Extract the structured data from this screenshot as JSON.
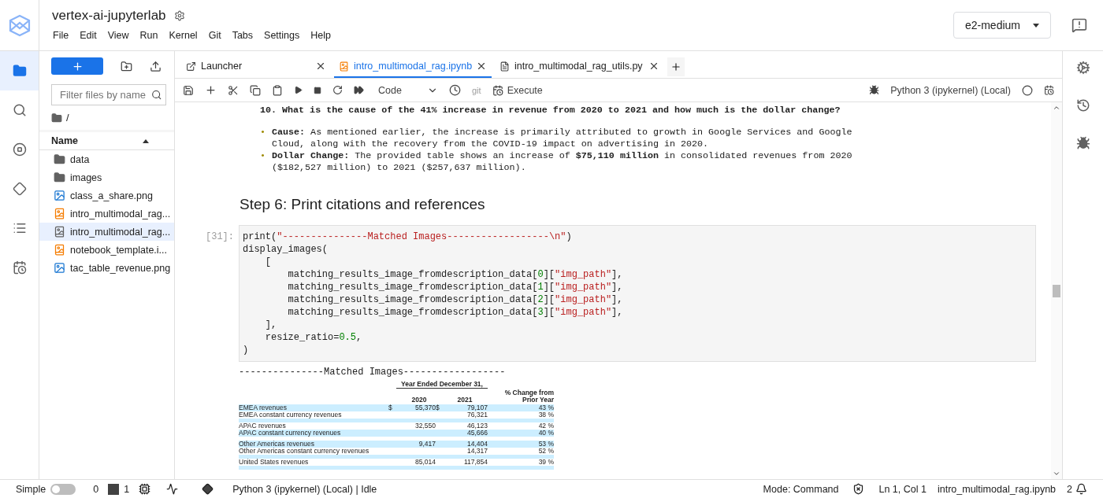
{
  "header": {
    "title": "vertex-ai-jupyterlab",
    "menu": [
      "File",
      "Edit",
      "View",
      "Run",
      "Kernel",
      "Git",
      "Tabs",
      "Settings",
      "Help"
    ],
    "machine": "e2-medium"
  },
  "activity_bar": [
    {
      "kind": "files",
      "selected": true
    },
    {
      "kind": "search",
      "selected": false
    },
    {
      "kind": "running",
      "selected": false
    },
    {
      "kind": "git",
      "selected": false
    },
    {
      "kind": "toc",
      "selected": false
    },
    {
      "kind": "scheduler",
      "selected": false
    }
  ],
  "file_browser": {
    "filter_placeholder": "Filter files by name",
    "path": "/",
    "column": "Name",
    "items": [
      {
        "name": "data",
        "kind": "folder",
        "selected": false
      },
      {
        "name": "images",
        "kind": "folder",
        "selected": false
      },
      {
        "name": "class_a_share.png",
        "kind": "image",
        "selected": false
      },
      {
        "name": "intro_multimodal_rag...",
        "kind": "notebook",
        "selected": false
      },
      {
        "name": "intro_multimodal_rag...",
        "kind": "file",
        "selected": true
      },
      {
        "name": "notebook_template.i...",
        "kind": "notebook",
        "selected": false
      },
      {
        "name": "tac_table_revenue.png",
        "kind": "image",
        "selected": false
      }
    ]
  },
  "tabs": [
    {
      "label": "Launcher",
      "kind": "launcher",
      "selected": false
    },
    {
      "label": "intro_multimodal_rag.ipynb",
      "kind": "notebook",
      "selected": true
    },
    {
      "label": "intro_multimodal_rag_utils.py",
      "kind": "text",
      "selected": false
    }
  ],
  "toolbar": {
    "cell_type": "Code",
    "git": "git",
    "execute": "Execute",
    "kernel": "Python 3 (ipykernel) (Local)"
  },
  "notebook": {
    "question": "10. What is the cause of the 41% increase in revenue from 2020 to 2021 and how much is the dollar change?",
    "bullets": [
      {
        "marker": "•",
        "text": "**Cause:**  As mentioned earlier, the increase is primarily attributed to growth in Google Services and Google Cloud, along with the recovery from the COVID-19 impact on advertising in 2020."
      },
      {
        "marker": "•",
        "text": "**Dollar Change:** The provided table shows an increase of **$75,110 million** in consolidated revenues from 2020 ($182,527 million) to 2021 ($257,637 million)."
      }
    ],
    "heading": "Step 6: Print citations and references",
    "prompt": "[31]:",
    "code": [
      "print(\"---------------Matched Images------------------\\n\")",
      "display_images(",
      "    [",
      "        matching_results_image_fromdescription_data[0][\"img_path\"],",
      "        matching_results_image_fromdescription_data[1][\"img_path\"],",
      "        matching_results_image_fromdescription_data[2][\"img_path\"],",
      "        matching_results_image_fromdescription_data[3][\"img_path\"],",
      "    ],",
      "    resize_ratio=0.5,",
      ")"
    ],
    "output_text": "---------------Matched Images------------------",
    "output_table": {
      "group": "Year Ended December 31,",
      "columns": [
        "2020",
        "2021",
        "% Change from Prior Year"
      ],
      "rows": [
        {
          "kind": "data",
          "cells": [
            "EMEA revenues",
            "$",
            "55,370",
            "$",
            "79,107",
            "43 %"
          ]
        },
        {
          "kind": "data",
          "cells": [
            "EMEA constant currency revenues",
            "",
            "",
            "",
            "76,321",
            "38 %"
          ]
        },
        {
          "kind": "spacer"
        },
        {
          "kind": "data",
          "cells": [
            "APAC revenues",
            "",
            "32,550",
            "",
            "46,123",
            "42 %"
          ]
        },
        {
          "kind": "data",
          "cells": [
            "APAC constant currency revenues",
            "",
            "",
            "",
            "45,666",
            "40 %"
          ]
        },
        {
          "kind": "spacer"
        },
        {
          "kind": "data",
          "cells": [
            "Other Americas revenues",
            "",
            "9,417",
            "",
            "14,404",
            "53 %"
          ]
        },
        {
          "kind": "data",
          "cells": [
            "Other Americas constant currency revenues",
            "",
            "",
            "",
            "14,317",
            "52 %"
          ]
        },
        {
          "kind": "spacer"
        },
        {
          "kind": "data",
          "cells": [
            "United States revenues",
            "",
            "85,014",
            "",
            "117,854",
            "39 %"
          ]
        },
        {
          "kind": "spacer"
        }
      ]
    }
  },
  "status_bar": {
    "mode_label": "Simple",
    "simple_on": false,
    "terminals": "0",
    "kernels": "1",
    "kernel_status": "Python 3 (ipykernel) (Local) | Idle",
    "mode": "Mode: Command",
    "position": "Ln 1, Col 1",
    "file": "intro_multimodal_rag.ipynb",
    "notifications": "2"
  }
}
